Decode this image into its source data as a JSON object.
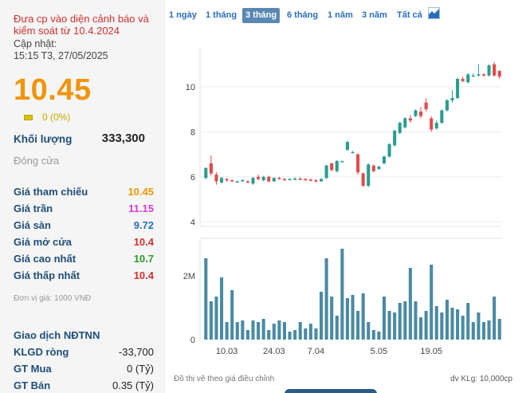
{
  "stock": {
    "warning": "Đưa cp vào diện cảnh báo và kiểm soát từ 10.4.2024",
    "updated_label": "Cập nhật:",
    "updated_time": "15:15 T3, 27/05/2025",
    "price": "10.45",
    "change": "0 (0%)",
    "volume_label": "Khối lượng",
    "volume": "333,300",
    "status": "Đóng cửa",
    "details": [
      {
        "label": "Giá tham chiếu",
        "value": "10.45",
        "color": "#f0940a"
      },
      {
        "label": "Giá trần",
        "value": "11.15",
        "color": "#d63ad6"
      },
      {
        "label": "Giá sàn",
        "value": "9.72",
        "color": "#2a6ebb"
      },
      {
        "label": "Giá mở cửa",
        "value": "10.4",
        "color": "#d0312d"
      },
      {
        "label": "Giá cao nhất",
        "value": "10.7",
        "color": "#2a9d2a"
      },
      {
        "label": "Giá thấp nhất",
        "value": "10.4",
        "color": "#d0312d"
      }
    ],
    "unit_note": "Đơn vị giá: 1000 VNĐ",
    "foreign_title": "Giao dịch NĐTNN",
    "foreign": [
      {
        "label": "KLGD ròng",
        "value": "-33,700"
      },
      {
        "label": "GT Mua",
        "value": "0 (Tỷ)"
      },
      {
        "label": "GT Bán",
        "value": "0.35 (Tỷ)"
      }
    ]
  },
  "tabs": [
    "1 ngày",
    "1 tháng",
    "3 tháng",
    "6 tháng",
    "1 năm",
    "3 năm",
    "Tất cả"
  ],
  "active_tab": "3 tháng",
  "footer": {
    "note": "Đồ thị vẽ theo giá điều chỉnh",
    "volume_unit": "dv KLg: 10,000cp"
  },
  "colors": {
    "up": "#2a9d8f",
    "down": "#e04b4b",
    "volume": "#4a8aa3"
  },
  "chart_data": {
    "type": "candlestick",
    "price_axis": {
      "ticks": [
        4,
        6,
        8,
        10
      ],
      "ylim": [
        3.8,
        11.8
      ]
    },
    "volume_axis": {
      "ticks": [
        "0",
        "2M"
      ]
    },
    "x_tick_labels": [
      "10.03",
      "24.03",
      "7.04",
      "5.05",
      "19.05"
    ],
    "candles": [
      {
        "o": 5.95,
        "h": 6.35,
        "l": 5.9,
        "c": 6.4,
        "v": 2.55
      },
      {
        "o": 6.6,
        "h": 6.95,
        "l": 6.05,
        "c": 6.15,
        "v": 1.2
      },
      {
        "o": 6.1,
        "h": 6.2,
        "l": 5.65,
        "c": 5.8,
        "v": 1.35
      },
      {
        "o": 5.75,
        "h": 6.0,
        "l": 5.7,
        "c": 5.95,
        "v": 1.95
      },
      {
        "o": 5.9,
        "h": 5.95,
        "l": 5.78,
        "c": 5.85,
        "v": 0.55
      },
      {
        "o": 5.85,
        "h": 5.88,
        "l": 5.78,
        "c": 5.82,
        "v": 1.55
      },
      {
        "o": 5.8,
        "h": 5.82,
        "l": 5.75,
        "c": 5.8,
        "v": 0.55
      },
      {
        "o": 5.82,
        "h": 5.9,
        "l": 5.78,
        "c": 5.85,
        "v": 0.6
      },
      {
        "o": 5.8,
        "h": 5.85,
        "l": 5.72,
        "c": 5.75,
        "v": 0.3
      },
      {
        "o": 5.7,
        "h": 6.0,
        "l": 5.65,
        "c": 5.95,
        "v": 0.6
      },
      {
        "o": 6.0,
        "h": 6.1,
        "l": 5.85,
        "c": 5.9,
        "v": 0.55
      },
      {
        "o": 5.85,
        "h": 6.05,
        "l": 5.8,
        "c": 6.0,
        "v": 0.65
      },
      {
        "o": 6.0,
        "h": 6.05,
        "l": 5.75,
        "c": 5.8,
        "v": 0.3
      },
      {
        "o": 5.8,
        "h": 5.98,
        "l": 5.78,
        "c": 5.95,
        "v": 0.5
      },
      {
        "o": 5.95,
        "h": 6.0,
        "l": 5.88,
        "c": 5.92,
        "v": 0.6
      },
      {
        "o": 5.9,
        "h": 5.95,
        "l": 5.82,
        "c": 5.88,
        "v": 0.55
      },
      {
        "o": 5.88,
        "h": 5.95,
        "l": 5.85,
        "c": 5.9,
        "v": 0.25
      },
      {
        "o": 5.9,
        "h": 5.98,
        "l": 5.85,
        "c": 5.92,
        "v": 0.3
      },
      {
        "o": 5.92,
        "h": 5.98,
        "l": 5.86,
        "c": 5.9,
        "v": 0.55
      },
      {
        "o": 5.9,
        "h": 5.95,
        "l": 5.84,
        "c": 5.88,
        "v": 0.35
      },
      {
        "o": 5.88,
        "h": 5.92,
        "l": 5.8,
        "c": 5.85,
        "v": 0.5
      },
      {
        "o": 5.85,
        "h": 5.9,
        "l": 5.75,
        "c": 5.8,
        "v": 0.35
      },
      {
        "o": 5.8,
        "h": 5.95,
        "l": 5.78,
        "c": 5.9,
        "v": 1.5
      },
      {
        "o": 5.95,
        "h": 6.55,
        "l": 5.9,
        "c": 6.5,
        "v": 2.55
      },
      {
        "o": 6.6,
        "h": 6.62,
        "l": 6.25,
        "c": 6.3,
        "v": 1.35
      },
      {
        "o": 6.25,
        "h": 6.75,
        "l": 6.2,
        "c": 6.7,
        "v": 0.75
      },
      {
        "o": 6.7,
        "h": 6.72,
        "l": 6.68,
        "c": 6.7,
        "v": 2.85
      },
      {
        "o": 7.2,
        "h": 7.6,
        "l": 7.15,
        "c": 7.55,
        "v": 1.3
      },
      {
        "o": 7.1,
        "h": 7.15,
        "l": 7.05,
        "c": 7.1,
        "v": 1.4
      },
      {
        "o": 7.0,
        "h": 7.05,
        "l": 6.1,
        "c": 6.2,
        "v": 0.9
      },
      {
        "o": 6.15,
        "h": 6.2,
        "l": 5.55,
        "c": 5.6,
        "v": 1.45
      },
      {
        "o": 5.6,
        "h": 6.6,
        "l": 5.55,
        "c": 6.55,
        "v": 0.55
      },
      {
        "o": 6.5,
        "h": 6.55,
        "l": 6.2,
        "c": 6.25,
        "v": 0.3
      },
      {
        "o": 6.35,
        "h": 6.5,
        "l": 6.3,
        "c": 6.45,
        "v": 0.25
      },
      {
        "o": 6.6,
        "h": 6.95,
        "l": 6.55,
        "c": 6.9,
        "v": 1.35
      },
      {
        "o": 6.9,
        "h": 7.5,
        "l": 6.85,
        "c": 7.45,
        "v": 0.9
      },
      {
        "o": 7.4,
        "h": 8.1,
        "l": 7.35,
        "c": 8.05,
        "v": 0.85
      },
      {
        "o": 7.95,
        "h": 8.45,
        "l": 7.9,
        "c": 8.4,
        "v": 1.15
      },
      {
        "o": 8.2,
        "h": 8.65,
        "l": 8.15,
        "c": 8.6,
        "v": 1.2
      },
      {
        "o": 8.6,
        "h": 8.75,
        "l": 8.4,
        "c": 8.5,
        "v": 2.25
      },
      {
        "o": 8.7,
        "h": 9.0,
        "l": 8.65,
        "c": 8.95,
        "v": 1.2
      },
      {
        "o": 8.9,
        "h": 9.1,
        "l": 8.6,
        "c": 8.7,
        "v": 0.7
      },
      {
        "o": 9.3,
        "h": 9.5,
        "l": 8.9,
        "c": 9.0,
        "v": 0.9
      },
      {
        "o": 8.6,
        "h": 8.7,
        "l": 8.0,
        "c": 8.1,
        "v": 2.35
      },
      {
        "o": 8.15,
        "h": 8.5,
        "l": 8.1,
        "c": 8.4,
        "v": 1.05
      },
      {
        "o": 8.4,
        "h": 9.0,
        "l": 8.35,
        "c": 8.95,
        "v": 0.85
      },
      {
        "o": 8.95,
        "h": 9.45,
        "l": 8.9,
        "c": 9.4,
        "v": 1.25
      },
      {
        "o": 9.4,
        "h": 9.85,
        "l": 9.3,
        "c": 9.5,
        "v": 1.0
      },
      {
        "o": 9.5,
        "h": 10.4,
        "l": 9.45,
        "c": 10.35,
        "v": 0.95
      },
      {
        "o": 10.35,
        "h": 10.45,
        "l": 10.2,
        "c": 10.25,
        "v": 0.75
      },
      {
        "o": 10.2,
        "h": 10.6,
        "l": 10.15,
        "c": 10.55,
        "v": 1.15
      },
      {
        "o": 10.5,
        "h": 10.6,
        "l": 10.45,
        "c": 10.5,
        "v": 0.55
      },
      {
        "o": 10.5,
        "h": 11.0,
        "l": 10.45,
        "c": 10.55,
        "v": 0.85
      },
      {
        "o": 10.55,
        "h": 10.6,
        "l": 10.45,
        "c": 10.5,
        "v": 0.55
      },
      {
        "o": 10.5,
        "h": 11.0,
        "l": 10.45,
        "c": 10.95,
        "v": 0.6
      },
      {
        "o": 11.0,
        "h": 11.1,
        "l": 10.45,
        "c": 10.5,
        "v": 1.35
      },
      {
        "o": 10.7,
        "h": 10.75,
        "l": 10.35,
        "c": 10.45,
        "v": 0.65
      }
    ]
  }
}
